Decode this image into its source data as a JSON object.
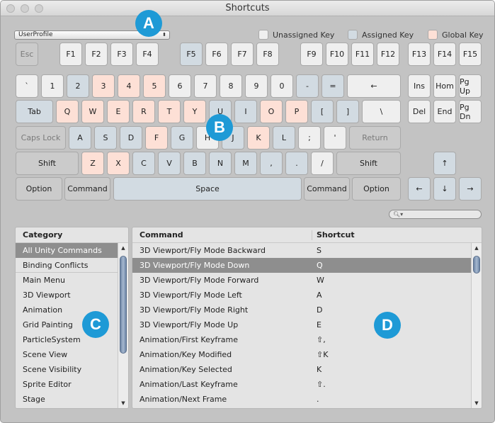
{
  "window": {
    "title": "Shortcuts"
  },
  "profile_dropdown": {
    "value": "UserProfile"
  },
  "legend": {
    "unassigned": "Unassigned Key",
    "assigned": "Assigned Key",
    "global": "Global Key"
  },
  "colors": {
    "unassigned": "#efefef",
    "assigned": "#d2dbe2",
    "global": "#fde0d6",
    "modifier": "#cbcbcb",
    "badge": "#1e9ad6",
    "selection": "#8e8e8e"
  },
  "keyboard": {
    "rows": [
      [
        {
          "label": "Esc",
          "state": "disabled"
        },
        {
          "label": "F1",
          "state": "unassigned"
        },
        {
          "label": "F2",
          "state": "unassigned"
        },
        {
          "label": "F3",
          "state": "unassigned"
        },
        {
          "label": "F4",
          "state": "unassigned"
        },
        {
          "label": "F5",
          "state": "assigned"
        },
        {
          "label": "F6",
          "state": "unassigned"
        },
        {
          "label": "F7",
          "state": "unassigned"
        },
        {
          "label": "F8",
          "state": "unassigned"
        },
        {
          "label": "F9",
          "state": "unassigned"
        },
        {
          "label": "F10",
          "state": "unassigned"
        },
        {
          "label": "F11",
          "state": "unassigned"
        },
        {
          "label": "F12",
          "state": "unassigned"
        },
        {
          "label": "F13",
          "state": "unassigned"
        },
        {
          "label": "F14",
          "state": "unassigned"
        },
        {
          "label": "F15",
          "state": "unassigned"
        }
      ],
      [
        {
          "label": "`",
          "state": "unassigned"
        },
        {
          "label": "1",
          "state": "unassigned"
        },
        {
          "label": "2",
          "state": "assigned"
        },
        {
          "label": "3",
          "state": "global"
        },
        {
          "label": "4",
          "state": "global"
        },
        {
          "label": "5",
          "state": "global"
        },
        {
          "label": "6",
          "state": "unassigned"
        },
        {
          "label": "7",
          "state": "unassigned"
        },
        {
          "label": "8",
          "state": "unassigned"
        },
        {
          "label": "9",
          "state": "unassigned"
        },
        {
          "label": "0",
          "state": "unassigned"
        },
        {
          "label": "-",
          "state": "assigned"
        },
        {
          "label": "=",
          "state": "assigned"
        },
        {
          "label": "←",
          "state": "unassigned"
        },
        {
          "label": "Ins",
          "state": "unassigned"
        },
        {
          "label": "Hom",
          "state": "unassigned"
        },
        {
          "label": "Pg Up",
          "state": "unassigned"
        }
      ],
      [
        {
          "label": "Tab",
          "state": "assigned"
        },
        {
          "label": "Q",
          "state": "global"
        },
        {
          "label": "W",
          "state": "global"
        },
        {
          "label": "E",
          "state": "global"
        },
        {
          "label": "R",
          "state": "global"
        },
        {
          "label": "T",
          "state": "global"
        },
        {
          "label": "Y",
          "state": "global"
        },
        {
          "label": "U",
          "state": "assigned"
        },
        {
          "label": "I",
          "state": "assigned"
        },
        {
          "label": "O",
          "state": "global"
        },
        {
          "label": "P",
          "state": "global"
        },
        {
          "label": "[",
          "state": "assigned"
        },
        {
          "label": "]",
          "state": "assigned"
        },
        {
          "label": "\\",
          "state": "unassigned"
        },
        {
          "label": "Del",
          "state": "unassigned"
        },
        {
          "label": "End",
          "state": "unassigned"
        },
        {
          "label": "Pg Dn",
          "state": "unassigned"
        }
      ],
      [
        {
          "label": "Caps Lock",
          "state": "disabled"
        },
        {
          "label": "A",
          "state": "assigned"
        },
        {
          "label": "S",
          "state": "assigned"
        },
        {
          "label": "D",
          "state": "assigned"
        },
        {
          "label": "F",
          "state": "global"
        },
        {
          "label": "G",
          "state": "assigned"
        },
        {
          "label": "H",
          "state": "unassigned"
        },
        {
          "label": "J",
          "state": "assigned"
        },
        {
          "label": "K",
          "state": "global"
        },
        {
          "label": "L",
          "state": "assigned"
        },
        {
          "label": ";",
          "state": "unassigned"
        },
        {
          "label": "'",
          "state": "unassigned"
        },
        {
          "label": "Return",
          "state": "disabled"
        }
      ],
      [
        {
          "label": "Shift",
          "state": "modifier"
        },
        {
          "label": "Z",
          "state": "global"
        },
        {
          "label": "X",
          "state": "global"
        },
        {
          "label": "C",
          "state": "assigned"
        },
        {
          "label": "V",
          "state": "assigned"
        },
        {
          "label": "B",
          "state": "assigned"
        },
        {
          "label": "N",
          "state": "assigned"
        },
        {
          "label": "M",
          "state": "assigned"
        },
        {
          "label": ",",
          "state": "assigned"
        },
        {
          "label": ".",
          "state": "assigned"
        },
        {
          "label": "/",
          "state": "unassigned"
        },
        {
          "label": "Shift",
          "state": "modifier"
        },
        {
          "label": "↑",
          "state": "assigned"
        }
      ],
      [
        {
          "label": "Option",
          "state": "modifier"
        },
        {
          "label": "Command",
          "state": "modifier"
        },
        {
          "label": "Space",
          "state": "assigned"
        },
        {
          "label": "Command",
          "state": "modifier"
        },
        {
          "label": "Option",
          "state": "modifier"
        },
        {
          "label": "←",
          "state": "assigned"
        },
        {
          "label": "↓",
          "state": "assigned"
        },
        {
          "label": "→",
          "state": "assigned"
        }
      ]
    ]
  },
  "search": {
    "icon": "search-icon",
    "value": ""
  },
  "category_panel": {
    "header": "Category",
    "items": [
      {
        "label": "All Unity Commands",
        "selected": true
      },
      {
        "label": "Binding Conflicts"
      },
      {
        "label": "Main Menu"
      },
      {
        "label": "3D Viewport"
      },
      {
        "label": "Animation"
      },
      {
        "label": "Grid Painting"
      },
      {
        "label": "ParticleSystem"
      },
      {
        "label": "Scene View"
      },
      {
        "label": "Scene Visibility"
      },
      {
        "label": "Sprite Editor"
      },
      {
        "label": "Stage"
      }
    ]
  },
  "command_panel": {
    "headers": {
      "command": "Command",
      "shortcut": "Shortcut"
    },
    "rows": [
      {
        "command": "3D Viewport/Fly Mode Backward",
        "shortcut": "S"
      },
      {
        "command": "3D Viewport/Fly Mode Down",
        "shortcut": "Q",
        "selected": true
      },
      {
        "command": "3D Viewport/Fly Mode Forward",
        "shortcut": "W"
      },
      {
        "command": "3D Viewport/Fly Mode Left",
        "shortcut": "A"
      },
      {
        "command": "3D Viewport/Fly Mode Right",
        "shortcut": "D"
      },
      {
        "command": "3D Viewport/Fly Mode Up",
        "shortcut": "E"
      },
      {
        "command": "Animation/First Keyframe",
        "shortcut": "⇧,"
      },
      {
        "command": "Animation/Key Modified",
        "shortcut": "⇧K"
      },
      {
        "command": "Animation/Key Selected",
        "shortcut": "K"
      },
      {
        "command": "Animation/Last Keyframe",
        "shortcut": "⇧."
      },
      {
        "command": "Animation/Next Frame",
        "shortcut": "."
      }
    ]
  },
  "callouts": [
    "A",
    "B",
    "C",
    "D"
  ]
}
